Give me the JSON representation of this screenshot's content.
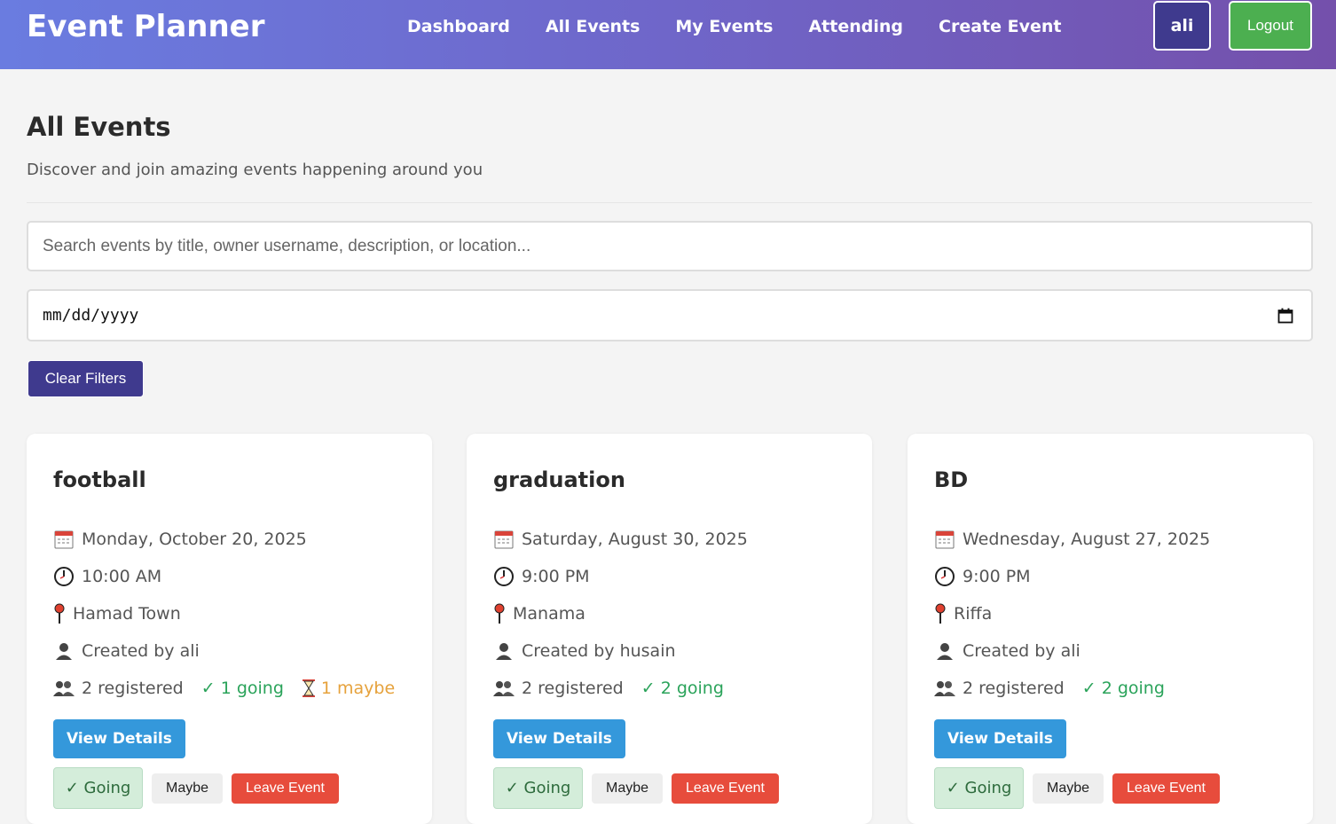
{
  "header": {
    "brand": "Event Planner",
    "nav": [
      "Dashboard",
      "All Events",
      "My Events",
      "Attending",
      "Create Event"
    ],
    "user": "ali",
    "logout": "Logout"
  },
  "page": {
    "title": "All Events",
    "subtitle": "Discover and join amazing events happening around you"
  },
  "filters": {
    "search_placeholder": "Search events by title, owner username, description, or location...",
    "date_value": "mm/dd/yyyy",
    "clear_label": "Clear Filters"
  },
  "events": [
    {
      "title": "football",
      "date": "Monday, October 20, 2025",
      "time": "10:00 AM",
      "location": "Hamad Town",
      "creator": "Created by ali",
      "registered": "2 registered",
      "going": "✓ 1 going",
      "maybe": "1 maybe",
      "view": "View Details",
      "rsvp_going": "✓ Going",
      "rsvp_maybe": "Maybe",
      "leave": "Leave Event"
    },
    {
      "title": "graduation",
      "date": "Saturday, August 30, 2025",
      "time": "9:00 PM",
      "location": "Manama",
      "creator": "Created by husain",
      "registered": "2 registered",
      "going": "✓ 2 going",
      "maybe": "",
      "view": "View Details",
      "rsvp_going": "✓ Going",
      "rsvp_maybe": "Maybe",
      "leave": "Leave Event"
    },
    {
      "title": "BD",
      "date": "Wednesday, August 27, 2025",
      "time": "9:00 PM",
      "location": "Riffa",
      "creator": "Created by ali",
      "registered": "2 registered",
      "going": "✓ 2 going",
      "maybe": "",
      "view": "View Details",
      "rsvp_going": "✓ Going",
      "rsvp_maybe": "Maybe",
      "leave": "Leave Event"
    }
  ],
  "colors": {
    "header_start": "#6a7ce0",
    "header_end": "#7450ab",
    "primary_dark": "#3f3a8e",
    "logout": "#4caf50",
    "view_button": "#3498db",
    "going_text": "#2aa35a",
    "maybe_text": "#e6a23c",
    "leave_button": "#e74c3c"
  }
}
